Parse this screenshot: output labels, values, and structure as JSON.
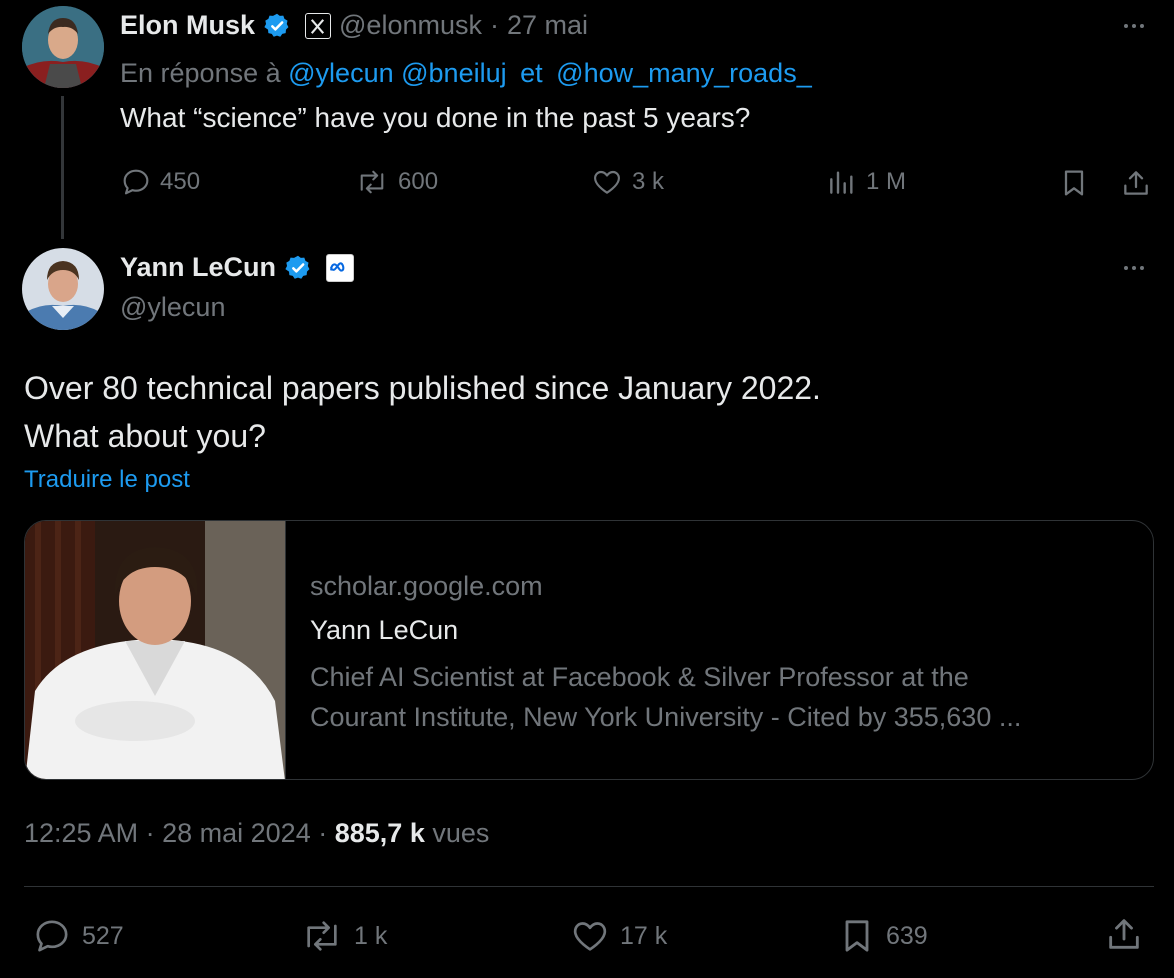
{
  "parent": {
    "author_name": "Elon Musk",
    "handle": "@elonmusk",
    "separator": "·",
    "date": "27 mai",
    "reply_prefix": "En réponse à",
    "mentions": [
      "@ylecun",
      "@bneiluj"
    ],
    "conjunction": "et",
    "last_mention": "@how_many_roads_",
    "text": "What “science” have you done in the past 5 years?",
    "stats": {
      "replies": "450",
      "reposts": "600",
      "likes": "3 k",
      "views": "1 M"
    }
  },
  "main": {
    "author_name": "Yann LeCun",
    "handle": "@ylecun",
    "text_line1": "Over 80 technical papers published since January 2022.",
    "text_line2": "What about you?",
    "translate": "Traduire le post",
    "card": {
      "domain": "scholar.google.com",
      "title": "Yann LeCun",
      "desc_line1": "Chief AI Scientist at Facebook & Silver Professor at the",
      "desc_line2": "Courant Institute, New York University - Cited by 355,630 ..."
    },
    "time": "12:25 AM",
    "sep": "·",
    "date": "28 mai 2024",
    "views_count": "885,7 k",
    "views_label": "vues",
    "stats": {
      "replies": "527",
      "reposts": "1 k",
      "likes": "17 k",
      "bookmarks": "639"
    }
  },
  "colors": {
    "accent": "#1d9bf0",
    "muted": "#71767b",
    "text": "#e7e9ea",
    "background": "#000000"
  }
}
